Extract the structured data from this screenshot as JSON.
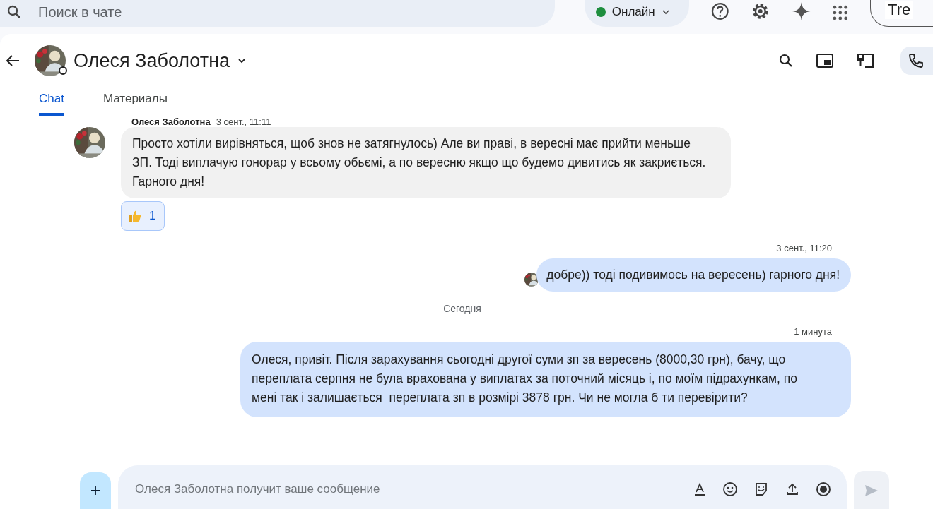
{
  "search": {
    "placeholder": "Поиск в чате"
  },
  "status": {
    "label": "Онлайн",
    "color": "#1e8e3e"
  },
  "account": {
    "label": "Tre"
  },
  "chat_header": {
    "title": "Олеся Заболотна"
  },
  "tabs": [
    {
      "label": "Chat",
      "selected": true
    },
    {
      "label": "Материалы",
      "selected": false
    }
  ],
  "messages": [
    {
      "kind": "incoming",
      "sender": "Олеся Заболотна",
      "time": "3 сент., 11:11",
      "text": "Просто хотіли вирівняться, щоб знов не затягнулось) Але ви праві, в вересні має прийти меньше ЗП. Тоді виплачую гонорар у всьому обьємі, а по вересню якщо що будемо дивитись як закриється. Гарного дня!",
      "reactions": [
        {
          "count": "1"
        }
      ]
    },
    {
      "kind": "outgoing",
      "time": "3 сент., 11:20",
      "text": "добре)) тоді подивимось на вересень) гарного дня!",
      "seen": true
    },
    {
      "kind": "divider",
      "text": "Сегодня"
    },
    {
      "kind": "outgoing",
      "time": "1 минута",
      "text": "Олеся, привіт. Після зарахування сьогодні другої суми зп за вересень (8000,30 грн), бачу, що переплата серпня не була врахована у виплатах за поточний місяць і, по моїм підрахункам, по мені так і залишається  переплата зп в розмірі 3878 грн. Чи не могла б ти перевірити?",
      "seen": false
    }
  ],
  "composer": {
    "placeholder": "Олеся Заболотна получит ваше сообщение"
  }
}
